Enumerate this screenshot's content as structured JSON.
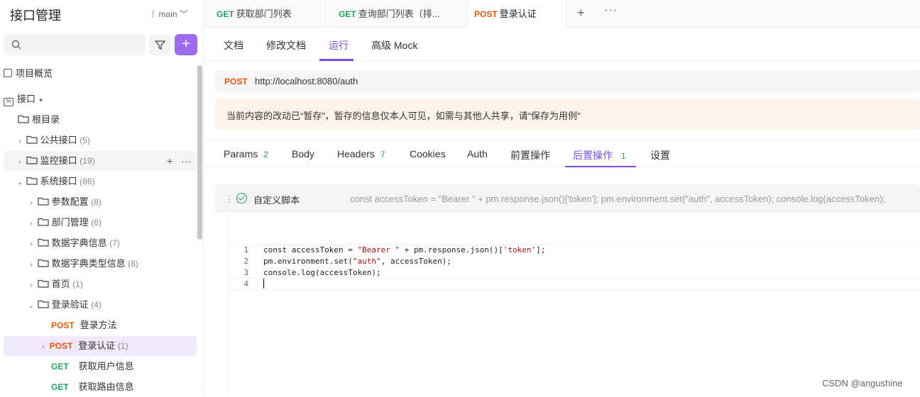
{
  "sidebar": {
    "title": "接口管理",
    "branch": "main",
    "overview_label": "项目概览",
    "api_label": "接口",
    "root_label": "根目录",
    "folders": [
      {
        "name": "公共接口",
        "count": "(5)"
      },
      {
        "name": "监控接口",
        "count": "(19)"
      },
      {
        "name": "系统接口",
        "count": "(86)"
      },
      {
        "name": "参数配置",
        "count": "(8)"
      },
      {
        "name": "部门管理",
        "count": "(6)"
      },
      {
        "name": "数据字典信息",
        "count": "(7)"
      },
      {
        "name": "数据字典类型信息",
        "count": "(8)"
      },
      {
        "name": "首页",
        "count": "(1)"
      },
      {
        "name": "登录验证",
        "count": "(4)"
      }
    ],
    "endpoints": [
      {
        "method": "POST",
        "name": "登录方法",
        "count": ""
      },
      {
        "method": "POST",
        "name": "登录认证",
        "count": "(1)"
      },
      {
        "method": "GET",
        "name": "获取用户信息",
        "count": ""
      },
      {
        "method": "GET",
        "name": "获取路由信息",
        "count": ""
      }
    ]
  },
  "tabs": [
    {
      "method": "GET",
      "label": "获取部门列表"
    },
    {
      "method": "GET",
      "label": "查询部门列表（排..."
    },
    {
      "method": "POST",
      "label": "登录认证"
    }
  ],
  "subnav": [
    "文档",
    "修改文档",
    "运行",
    "高级 Mock"
  ],
  "request": {
    "method": "POST",
    "url": "http://localhost:8080/auth"
  },
  "notice": "当前内容的改动已“暂存”，暂存的信息仅本人可见，如需与其他人共享，请“保存为用例”",
  "req_tabs": [
    {
      "label": "Params",
      "count": "2"
    },
    {
      "label": "Body",
      "count": ""
    },
    {
      "label": "Headers",
      "count": "7"
    },
    {
      "label": "Cookies",
      "count": ""
    },
    {
      "label": "Auth",
      "count": ""
    },
    {
      "label": "前置操作",
      "count": ""
    },
    {
      "label": "后置操作",
      "count": "1"
    },
    {
      "label": "设置",
      "count": ""
    }
  ],
  "script": {
    "title": "自定义脚本",
    "preview": "const accessToken = \"Bearer \" + pm.response.json()['token']; pm.environment.set(\"auth\", accessToken); console.log(accessToken);",
    "line_numbers": [
      "1",
      "2",
      "3",
      "4"
    ],
    "lines": {
      "l1a": "const accessToken = ",
      "l1b": "\"Bearer \"",
      "l1c": " + pm.response.json()[",
      "l1d": "'token'",
      "l1e": "];",
      "l2a": "pm.environment.set(",
      "l2b": "\"auth\"",
      "l2c": ", accessToken);",
      "l3": "console.log(accessToken);"
    }
  },
  "watermark": "CSDN @angushine",
  "colors": {
    "accent": "#7b4fe0",
    "post": "#e8590c",
    "get": "#21a366",
    "notice_bg": "#fff4ec"
  }
}
